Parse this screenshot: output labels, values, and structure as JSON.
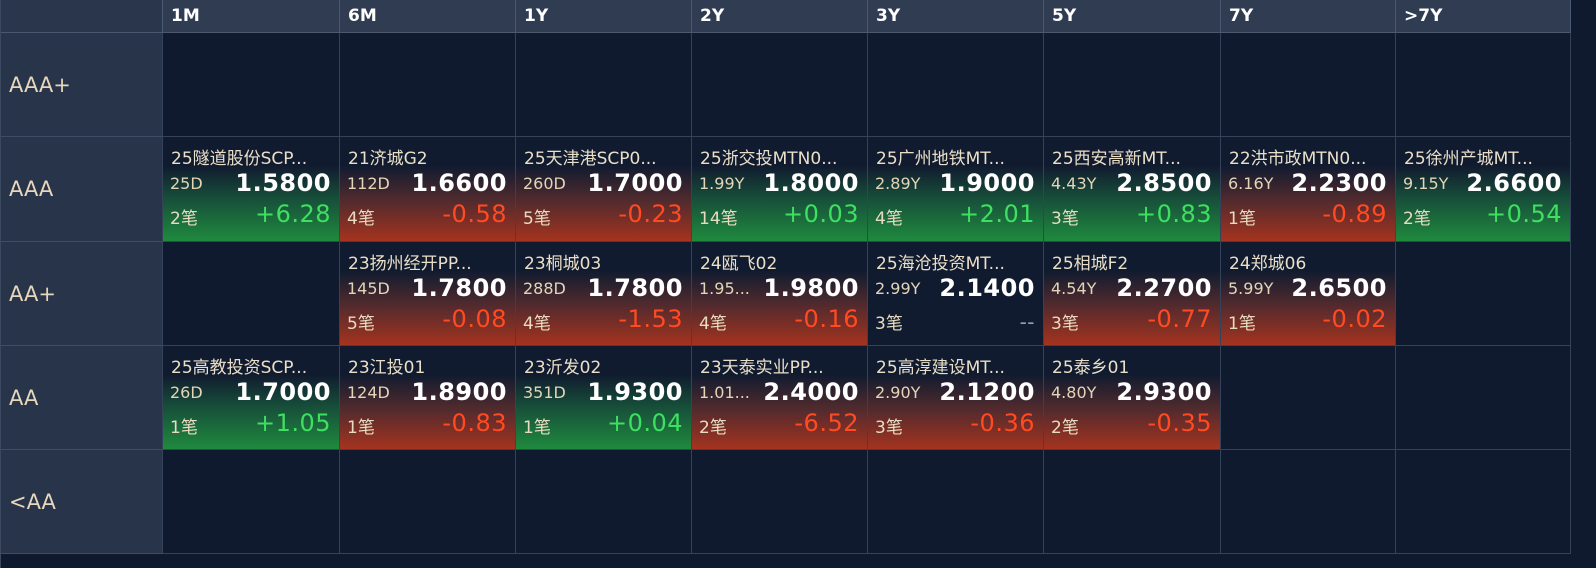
{
  "columns": [
    "1M",
    "6M",
    "1Y",
    "2Y",
    "3Y",
    "5Y",
    "7Y",
    ">7Y"
  ],
  "rows": [
    "AAA+",
    "AAA",
    "AA+",
    "AA",
    "<AA"
  ],
  "colors": {
    "up": "#3ee060",
    "down": "#ff4a22",
    "label": "#e8d7bc"
  },
  "cells": {
    "r1": [
      {
        "name": "25隧道股份SCP...",
        "term": "25D",
        "rate": "1.5800",
        "count": "2笔",
        "change": "+6.28",
        "trend": "up"
      },
      {
        "name": "21济城G2",
        "term": "112D",
        "rate": "1.6600",
        "count": "4笔",
        "change": "-0.58",
        "trend": "down"
      },
      {
        "name": "25天津港SCP0...",
        "term": "260D",
        "rate": "1.7000",
        "count": "5笔",
        "change": "-0.23",
        "trend": "down"
      },
      {
        "name": "25浙交投MTN0...",
        "term": "1.99Y",
        "rate": "1.8000",
        "count": "14笔",
        "change": "+0.03",
        "trend": "up"
      },
      {
        "name": "25广州地铁MT...",
        "term": "2.89Y",
        "rate": "1.9000",
        "count": "4笔",
        "change": "+2.01",
        "trend": "up"
      },
      {
        "name": "25西安高新MT...",
        "term": "4.43Y",
        "rate": "2.8500",
        "count": "3笔",
        "change": "+0.83",
        "trend": "up"
      },
      {
        "name": "22洪市政MTN0...",
        "term": "6.16Y",
        "rate": "2.2300",
        "count": "1笔",
        "change": "-0.89",
        "trend": "down"
      },
      {
        "name": "25徐州产城MT...",
        "term": "9.15Y",
        "rate": "2.6600",
        "count": "2笔",
        "change": "+0.54",
        "trend": "up"
      }
    ],
    "r2": [
      null,
      {
        "name": "23扬州经开PP...",
        "term": "145D",
        "rate": "1.7800",
        "count": "5笔",
        "change": "-0.08",
        "trend": "down"
      },
      {
        "name": "23桐城03",
        "term": "288D",
        "rate": "1.7800",
        "count": "4笔",
        "change": "-1.53",
        "trend": "down"
      },
      {
        "name": "24瓯飞02",
        "term": "1.95...",
        "rate": "1.9800",
        "count": "4笔",
        "change": "-0.16",
        "trend": "down"
      },
      {
        "name": "25海沧投资MT...",
        "term": "2.99Y",
        "rate": "2.1400",
        "count": "3笔",
        "change": "--",
        "trend": "flat"
      },
      {
        "name": "25相城F2",
        "term": "4.54Y",
        "rate": "2.2700",
        "count": "3笔",
        "change": "-0.77",
        "trend": "down"
      },
      {
        "name": "24郑城06",
        "term": "5.99Y",
        "rate": "2.6500",
        "count": "1笔",
        "change": "-0.02",
        "trend": "down"
      },
      null
    ],
    "r3": [
      {
        "name": "25高教投资SCP...",
        "term": "26D",
        "rate": "1.7000",
        "count": "1笔",
        "change": "+1.05",
        "trend": "up"
      },
      {
        "name": "23江投01",
        "term": "124D",
        "rate": "1.8900",
        "count": "1笔",
        "change": "-0.83",
        "trend": "down"
      },
      {
        "name": "23沂发02",
        "term": "351D",
        "rate": "1.9300",
        "count": "1笔",
        "change": "+0.04",
        "trend": "up"
      },
      {
        "name": "23天泰实业PP...",
        "term": "1.01...",
        "rate": "2.4000",
        "count": "2笔",
        "change": "-6.52",
        "trend": "down"
      },
      {
        "name": "25高淳建设MT...",
        "term": "2.90Y",
        "rate": "2.1200",
        "count": "3笔",
        "change": "-0.36",
        "trend": "down"
      },
      {
        "name": "25泰乡01",
        "term": "4.80Y",
        "rate": "2.9300",
        "count": "2笔",
        "change": "-0.35",
        "trend": "down"
      },
      null,
      null
    ]
  }
}
